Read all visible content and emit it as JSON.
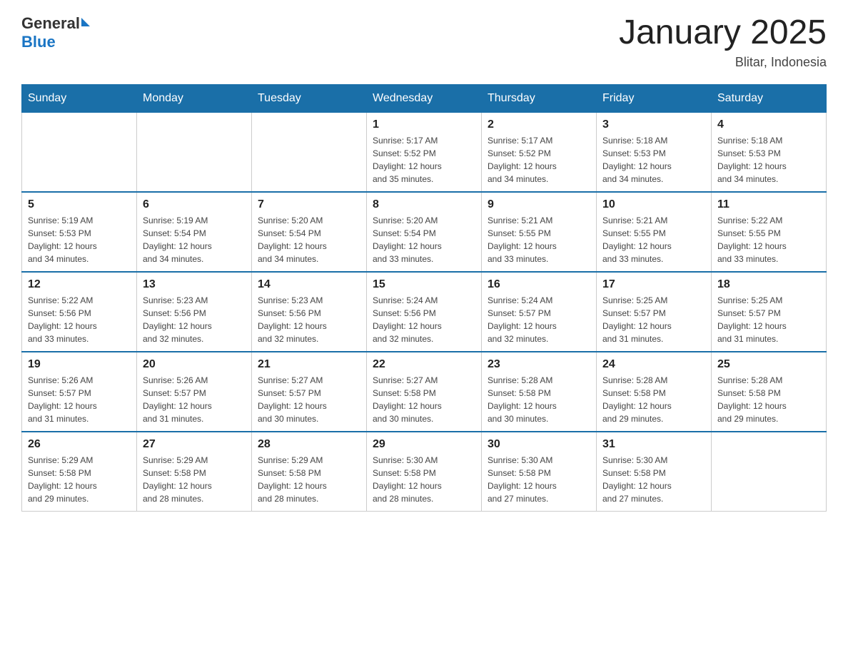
{
  "header": {
    "logo": {
      "general": "General",
      "blue": "Blue"
    },
    "title": "January 2025",
    "location": "Blitar, Indonesia"
  },
  "days_of_week": [
    "Sunday",
    "Monday",
    "Tuesday",
    "Wednesday",
    "Thursday",
    "Friday",
    "Saturday"
  ],
  "weeks": [
    [
      {
        "day": "",
        "info": ""
      },
      {
        "day": "",
        "info": ""
      },
      {
        "day": "",
        "info": ""
      },
      {
        "day": "1",
        "info": "Sunrise: 5:17 AM\nSunset: 5:52 PM\nDaylight: 12 hours\nand 35 minutes."
      },
      {
        "day": "2",
        "info": "Sunrise: 5:17 AM\nSunset: 5:52 PM\nDaylight: 12 hours\nand 34 minutes."
      },
      {
        "day": "3",
        "info": "Sunrise: 5:18 AM\nSunset: 5:53 PM\nDaylight: 12 hours\nand 34 minutes."
      },
      {
        "day": "4",
        "info": "Sunrise: 5:18 AM\nSunset: 5:53 PM\nDaylight: 12 hours\nand 34 minutes."
      }
    ],
    [
      {
        "day": "5",
        "info": "Sunrise: 5:19 AM\nSunset: 5:53 PM\nDaylight: 12 hours\nand 34 minutes."
      },
      {
        "day": "6",
        "info": "Sunrise: 5:19 AM\nSunset: 5:54 PM\nDaylight: 12 hours\nand 34 minutes."
      },
      {
        "day": "7",
        "info": "Sunrise: 5:20 AM\nSunset: 5:54 PM\nDaylight: 12 hours\nand 34 minutes."
      },
      {
        "day": "8",
        "info": "Sunrise: 5:20 AM\nSunset: 5:54 PM\nDaylight: 12 hours\nand 33 minutes."
      },
      {
        "day": "9",
        "info": "Sunrise: 5:21 AM\nSunset: 5:55 PM\nDaylight: 12 hours\nand 33 minutes."
      },
      {
        "day": "10",
        "info": "Sunrise: 5:21 AM\nSunset: 5:55 PM\nDaylight: 12 hours\nand 33 minutes."
      },
      {
        "day": "11",
        "info": "Sunrise: 5:22 AM\nSunset: 5:55 PM\nDaylight: 12 hours\nand 33 minutes."
      }
    ],
    [
      {
        "day": "12",
        "info": "Sunrise: 5:22 AM\nSunset: 5:56 PM\nDaylight: 12 hours\nand 33 minutes."
      },
      {
        "day": "13",
        "info": "Sunrise: 5:23 AM\nSunset: 5:56 PM\nDaylight: 12 hours\nand 32 minutes."
      },
      {
        "day": "14",
        "info": "Sunrise: 5:23 AM\nSunset: 5:56 PM\nDaylight: 12 hours\nand 32 minutes."
      },
      {
        "day": "15",
        "info": "Sunrise: 5:24 AM\nSunset: 5:56 PM\nDaylight: 12 hours\nand 32 minutes."
      },
      {
        "day": "16",
        "info": "Sunrise: 5:24 AM\nSunset: 5:57 PM\nDaylight: 12 hours\nand 32 minutes."
      },
      {
        "day": "17",
        "info": "Sunrise: 5:25 AM\nSunset: 5:57 PM\nDaylight: 12 hours\nand 31 minutes."
      },
      {
        "day": "18",
        "info": "Sunrise: 5:25 AM\nSunset: 5:57 PM\nDaylight: 12 hours\nand 31 minutes."
      }
    ],
    [
      {
        "day": "19",
        "info": "Sunrise: 5:26 AM\nSunset: 5:57 PM\nDaylight: 12 hours\nand 31 minutes."
      },
      {
        "day": "20",
        "info": "Sunrise: 5:26 AM\nSunset: 5:57 PM\nDaylight: 12 hours\nand 31 minutes."
      },
      {
        "day": "21",
        "info": "Sunrise: 5:27 AM\nSunset: 5:57 PM\nDaylight: 12 hours\nand 30 minutes."
      },
      {
        "day": "22",
        "info": "Sunrise: 5:27 AM\nSunset: 5:58 PM\nDaylight: 12 hours\nand 30 minutes."
      },
      {
        "day": "23",
        "info": "Sunrise: 5:28 AM\nSunset: 5:58 PM\nDaylight: 12 hours\nand 30 minutes."
      },
      {
        "day": "24",
        "info": "Sunrise: 5:28 AM\nSunset: 5:58 PM\nDaylight: 12 hours\nand 29 minutes."
      },
      {
        "day": "25",
        "info": "Sunrise: 5:28 AM\nSunset: 5:58 PM\nDaylight: 12 hours\nand 29 minutes."
      }
    ],
    [
      {
        "day": "26",
        "info": "Sunrise: 5:29 AM\nSunset: 5:58 PM\nDaylight: 12 hours\nand 29 minutes."
      },
      {
        "day": "27",
        "info": "Sunrise: 5:29 AM\nSunset: 5:58 PM\nDaylight: 12 hours\nand 28 minutes."
      },
      {
        "day": "28",
        "info": "Sunrise: 5:29 AM\nSunset: 5:58 PM\nDaylight: 12 hours\nand 28 minutes."
      },
      {
        "day": "29",
        "info": "Sunrise: 5:30 AM\nSunset: 5:58 PM\nDaylight: 12 hours\nand 28 minutes."
      },
      {
        "day": "30",
        "info": "Sunrise: 5:30 AM\nSunset: 5:58 PM\nDaylight: 12 hours\nand 27 minutes."
      },
      {
        "day": "31",
        "info": "Sunrise: 5:30 AM\nSunset: 5:58 PM\nDaylight: 12 hours\nand 27 minutes."
      },
      {
        "day": "",
        "info": ""
      }
    ]
  ]
}
